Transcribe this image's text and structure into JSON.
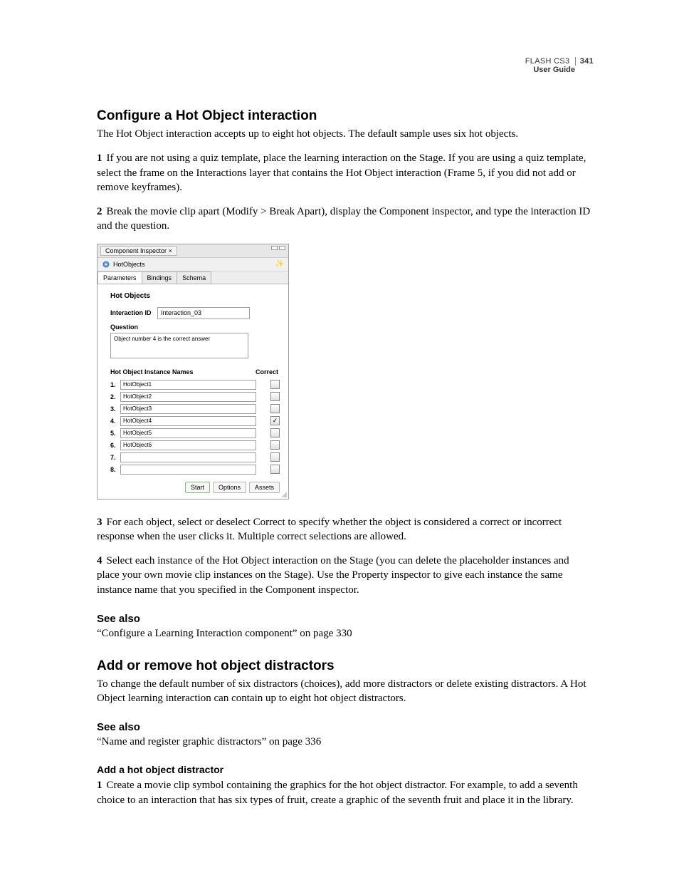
{
  "header": {
    "product": "FLASH CS3",
    "pagenum": "341",
    "guide": "User Guide"
  },
  "section1": {
    "title": "Configure a Hot Object interaction",
    "intro": "The Hot Object interaction accepts up to eight hot objects. The default sample uses six hot objects.",
    "step1_num": "1",
    "step1": "If you are not using a quiz template, place the learning interaction on the Stage. If you are using a quiz template, select the frame on the Interactions layer that contains the Hot Object interaction (Frame 5, if you did not add or remove keyframes).",
    "step2_num": "2",
    "step2": "Break the movie clip apart (Modify > Break Apart), display the Component inspector, and type the interaction ID and the question.",
    "step3_num": "3",
    "step3": "For each object, select or deselect Correct to specify whether the object is considered a correct or incorrect response when the user clicks it. Multiple correct selections are allowed.",
    "step4_num": "4",
    "step4": "Select each instance of the Hot Object interaction on the Stage (you can delete the placeholder instances and place your own movie clip instances on the Stage). Use the Property inspector to give each instance the same instance name that you specified in the Component inspector."
  },
  "seealso1": {
    "heading": "See also",
    "ref": "“Configure a Learning Interaction component” on page 330"
  },
  "section2": {
    "title": "Add or remove hot object distractors",
    "intro": "To change the default number of six distractors (choices), add more distractors or delete existing distractors. A Hot Object learning interaction can contain up to eight hot object distractors."
  },
  "seealso2": {
    "heading": "See also",
    "ref": "“Name and register graphic distractors” on page 336"
  },
  "section3": {
    "title": "Add a hot object distractor",
    "step1_num": "1",
    "step1": "Create a movie clip symbol containing the graphics for the hot object distractor. For example, to add a seventh choice to an interaction that has six types of fruit, create a graphic of the seventh fruit and place it in the library."
  },
  "inspector": {
    "window_title": "Component Inspector",
    "close_x": "×",
    "component_name": "HotObjects",
    "tabs": {
      "parameters": "Parameters",
      "bindings": "Bindings",
      "schema": "Schema"
    },
    "panel_title": "Hot Objects",
    "interaction_id_label": "Interaction ID",
    "interaction_id_value": "Interaction_03",
    "question_label": "Question",
    "question_value": "Object number 4 is the correct answer",
    "list_header_names": "Hot Object Instance Names",
    "list_header_correct": "Correct",
    "items": [
      {
        "n": "1.",
        "name": "HotObject1",
        "correct": false
      },
      {
        "n": "2.",
        "name": "HotObject2",
        "correct": false
      },
      {
        "n": "3.",
        "name": "HotObject3",
        "correct": false
      },
      {
        "n": "4.",
        "name": "HotObject4",
        "correct": true
      },
      {
        "n": "5.",
        "name": "HotObject5",
        "correct": false
      },
      {
        "n": "6.",
        "name": "HotObject6",
        "correct": false
      },
      {
        "n": "7.",
        "name": "",
        "correct": false
      },
      {
        "n": "8.",
        "name": "",
        "correct": false
      }
    ],
    "buttons": {
      "start": "Start",
      "options": "Options",
      "assets": "Assets"
    }
  }
}
